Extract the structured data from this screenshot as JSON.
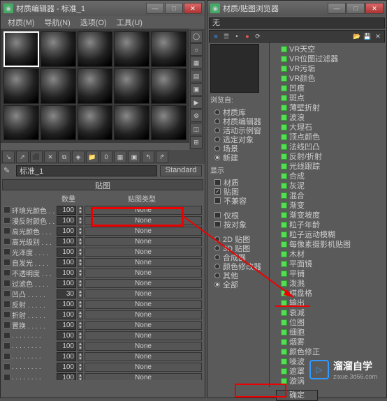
{
  "editor": {
    "title": "材质编辑器 - 标准_1",
    "menu": [
      "材质(M)",
      "导航(N)",
      "选项(O)",
      "工具(U)"
    ],
    "material_name": "标准_1",
    "type_button": "Standard",
    "section_title": "贴图",
    "col_amount": "数量",
    "col_maptype": "贴图类型",
    "rows": [
      {
        "name": "环境光颜色 . . .",
        "val": "100",
        "map": "None"
      },
      {
        "name": "漫反射颜色 . . .",
        "val": "100",
        "map": "None"
      },
      {
        "name": "高光颜色 . . .",
        "val": "100",
        "map": "None"
      },
      {
        "name": "高光级别 . . .",
        "val": "100",
        "map": "None"
      },
      {
        "name": "光泽度 . . . .",
        "val": "100",
        "map": "None"
      },
      {
        "name": "自发光 . . . .",
        "val": "100",
        "map": "None"
      },
      {
        "name": "不透明度 . . .",
        "val": "100",
        "map": "None"
      },
      {
        "name": "过滤色 . . . .",
        "val": "100",
        "map": "None"
      },
      {
        "name": "凹凸 . . . . .",
        "val": "30",
        "map": "None"
      },
      {
        "name": "反射 . . . . .",
        "val": "100",
        "map": "None"
      },
      {
        "name": "折射 . . . . .",
        "val": "100",
        "map": "None"
      },
      {
        "name": "置换 . . . . .",
        "val": "100",
        "map": "None"
      },
      {
        "name": ". . . . . . . .",
        "val": "100",
        "map": "None"
      },
      {
        "name": ". . . . . . . .",
        "val": "100",
        "map": "None"
      },
      {
        "name": ". . . . . . . .",
        "val": "100",
        "map": "None"
      },
      {
        "name": ". . . . . . . .",
        "val": "100",
        "map": "None"
      },
      {
        "name": ". . . . . . . .",
        "val": "100",
        "map": "None"
      }
    ]
  },
  "browser": {
    "title": "材质/贴图浏览器",
    "none": "无",
    "browse_from": "浏览自:",
    "browse_opts": [
      "材质库",
      "材质编辑器",
      "活动示例窗",
      "选定对象",
      "场景",
      "新建"
    ],
    "browse_sel": 5,
    "show": "显示",
    "show_opts": [
      {
        "label": "材质",
        "on": false
      },
      {
        "label": "贴图",
        "on": true
      },
      {
        "label": "不兼容",
        "on": false
      }
    ],
    "show_opts2": [
      {
        "label": "仅根",
        "on": false
      },
      {
        "label": "按对象",
        "on": false
      }
    ],
    "extra_checks": [
      {
        "label": "2D 贴图",
        "on": false
      },
      {
        "label": "3D 贴图",
        "on": false
      },
      {
        "label": "合成器",
        "on": false
      },
      {
        "label": "颜色修改器",
        "on": false
      },
      {
        "label": "其他",
        "on": false
      },
      {
        "label": "全部",
        "on": true
      }
    ],
    "tree": [
      "VR天空",
      "VR位图过滤器",
      "VR污垢",
      "VR颜色",
      "凹痕",
      "斑点",
      "薄壁折射",
      "波浪",
      "大理石",
      "顶点颜色",
      "法线凹凸",
      "反射/折射",
      "光线跟踪",
      "合成",
      "灰泥",
      "混合",
      "渐变",
      "渐变坡度",
      "粒子年龄",
      "粒子运动模糊",
      "每像素摄影机贴图",
      "木材",
      "平面镜",
      "平铺",
      "泼溅",
      "棋盘格",
      "输出",
      "衰减",
      "位图",
      "细胞",
      "烟雾",
      "颜色修正",
      "噪波",
      "遮罩",
      "漩涡"
    ],
    "ok": "确定"
  },
  "watermark": {
    "brand": "溜溜自学",
    "url": "zixue.3d66.com"
  }
}
